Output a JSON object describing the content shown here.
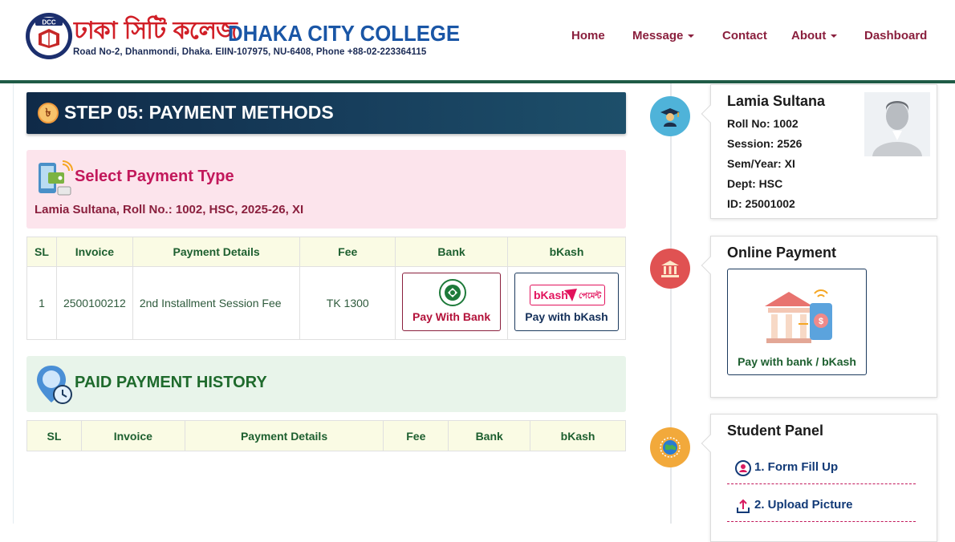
{
  "header": {
    "logo_text_bn": "ঢাকা সিটি কলেজ",
    "logo_text_en": "DHAKA CITY COLLEGE",
    "address": "Road No-2, Dhanmondi, Dhaka. EIIN-107975, NU-6408, Phone +88-02-223364115",
    "logo_badge": "DCC",
    "nav": [
      {
        "label": "Home"
      },
      {
        "label": "Message"
      },
      {
        "label": "Contact"
      },
      {
        "label": "About"
      },
      {
        "label": "Dashboard"
      }
    ]
  },
  "step": {
    "icon_glyph": "৳",
    "title": "STEP 05: PAYMENT METHODS"
  },
  "payment_type": {
    "title": "Select Payment Type",
    "subtitle": "Lamia Sultana, Roll No.: 1002, HSC, 2025-26, XI"
  },
  "payment_table": {
    "headers": [
      "SL",
      "Invoice",
      "Payment Details",
      "Fee",
      "Bank",
      "bKash"
    ],
    "rows": [
      {
        "sl": "1",
        "invoice": "2500100212",
        "details": "2nd Installment Session Fee",
        "fee": "TK 1300",
        "bank_label": "Pay With Bank",
        "bkash_label": "Pay with bKash",
        "bkash_logo_text": "bKash",
        "bkash_logo_bn": "পেমেন্ট"
      }
    ]
  },
  "history": {
    "title": "PAID PAYMENT HISTORY",
    "headers": [
      "SL",
      "Invoice",
      "Payment Details",
      "Fee",
      "Bank",
      "bKash"
    ]
  },
  "profile": {
    "name": "Lamia Sultana",
    "roll": "Roll No: 1002",
    "session": "Session: 2526",
    "sem_year": "Sem/Year: XI",
    "dept": "Dept: HSC",
    "id": "ID: 25001002"
  },
  "online_payment": {
    "title": "Online Payment",
    "button_label": "Pay with bank / bKash"
  },
  "student_panel": {
    "title": "Student Panel",
    "items": [
      {
        "label": "1. Form Fill Up",
        "icon": "user-circle-icon"
      },
      {
        "label": "2. Upload Picture",
        "icon": "upload-icon"
      }
    ]
  },
  "colors": {
    "brand_red": "#d11f27",
    "brand_blue": "#1a56a6",
    "nav_maroon": "#8a1f3d",
    "header_rule": "#1f5b46",
    "step_bar": "#0f2a48",
    "pink_panel": "#fce4ec",
    "green_panel": "#e8f4ea"
  },
  "icons": {
    "timeline_profile": "graduate-icon",
    "timeline_payment": "bank-icon",
    "timeline_panel": "globe-icon"
  }
}
